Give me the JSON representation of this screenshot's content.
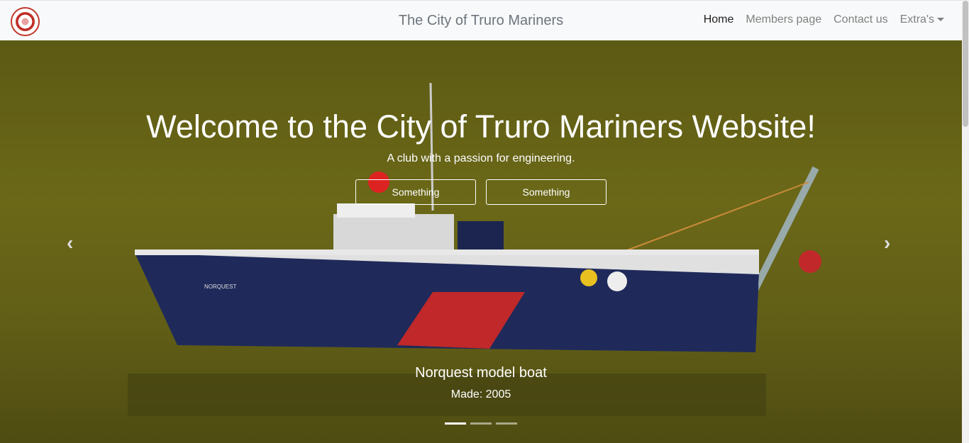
{
  "navbar": {
    "brand": "The City of Truro Mariners",
    "links": [
      "Home",
      "Members page",
      "Contact us",
      "Extra's"
    ]
  },
  "hero": {
    "heading": "Welcome to the City of Truro Mariners Website!",
    "subheading": "A club with a passion for engineering.",
    "buttons": [
      "Something",
      "Something"
    ],
    "caption_title": "Norquest model boat",
    "caption_sub": "Made: 2005",
    "boat_label": "NORQUEST",
    "prev_icon": "chevron-left-icon",
    "next_icon": "chevron-right-icon",
    "indicator_count": 3,
    "active_slide": 1
  },
  "colors": {
    "accent": "#4a90d9",
    "water": "#6b6818",
    "hull": "#1f2a5a",
    "stripe": "#c0282a"
  }
}
